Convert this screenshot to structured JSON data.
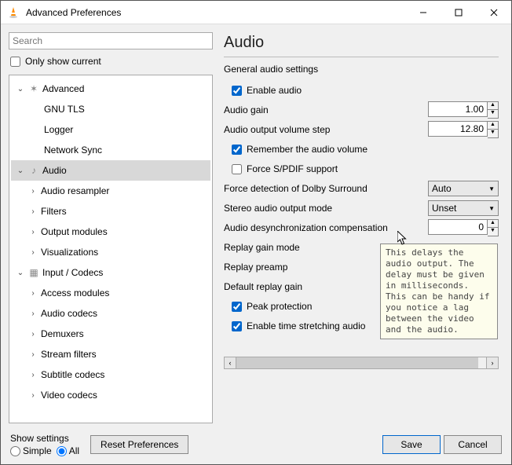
{
  "window": {
    "title": "Advanced Preferences"
  },
  "search": {
    "placeholder": "Search"
  },
  "only_show_current": "Only show current",
  "tree": {
    "advanced": "Advanced",
    "gnu_tls": "GNU TLS",
    "logger": "Logger",
    "network_sync": "Network Sync",
    "audio": "Audio",
    "audio_resampler": "Audio resampler",
    "filters": "Filters",
    "output_modules": "Output modules",
    "visualizations": "Visualizations",
    "input_codecs": "Input / Codecs",
    "access_modules": "Access modules",
    "audio_codecs": "Audio codecs",
    "demuxers": "Demuxers",
    "stream_filters": "Stream filters",
    "subtitle_codecs": "Subtitle codecs",
    "video_codecs": "Video codecs"
  },
  "panel": {
    "title": "Audio",
    "subtitle": "General audio settings",
    "enable_audio": "Enable audio",
    "audio_gain": "Audio gain",
    "audio_gain_val": "1.00",
    "volume_step": "Audio output volume step",
    "volume_step_val": "12.80",
    "remember_volume": "Remember the audio volume",
    "force_spdif": "Force S/PDIF support",
    "dolby_detect": "Force detection of Dolby Surround",
    "dolby_val": "Auto",
    "stereo_mode": "Stereo audio output mode",
    "stereo_val": "Unset",
    "desync": "Audio desynchronization compensation",
    "desync_val": "0",
    "replay_gain_mode": "Replay gain mode",
    "replay_preamp": "Replay preamp",
    "default_replay_gain": "Default replay gain",
    "peak_protection": "Peak protection",
    "time_stretching": "Enable time stretching audio"
  },
  "tooltip": "This delays the audio output. The delay must be given in milliseconds. This can be handy if you notice a lag between the video and the audio.",
  "bottom": {
    "show_settings": "Show settings",
    "simple": "Simple",
    "all": "All",
    "reset": "Reset Preferences",
    "save": "Save",
    "cancel": "Cancel"
  }
}
